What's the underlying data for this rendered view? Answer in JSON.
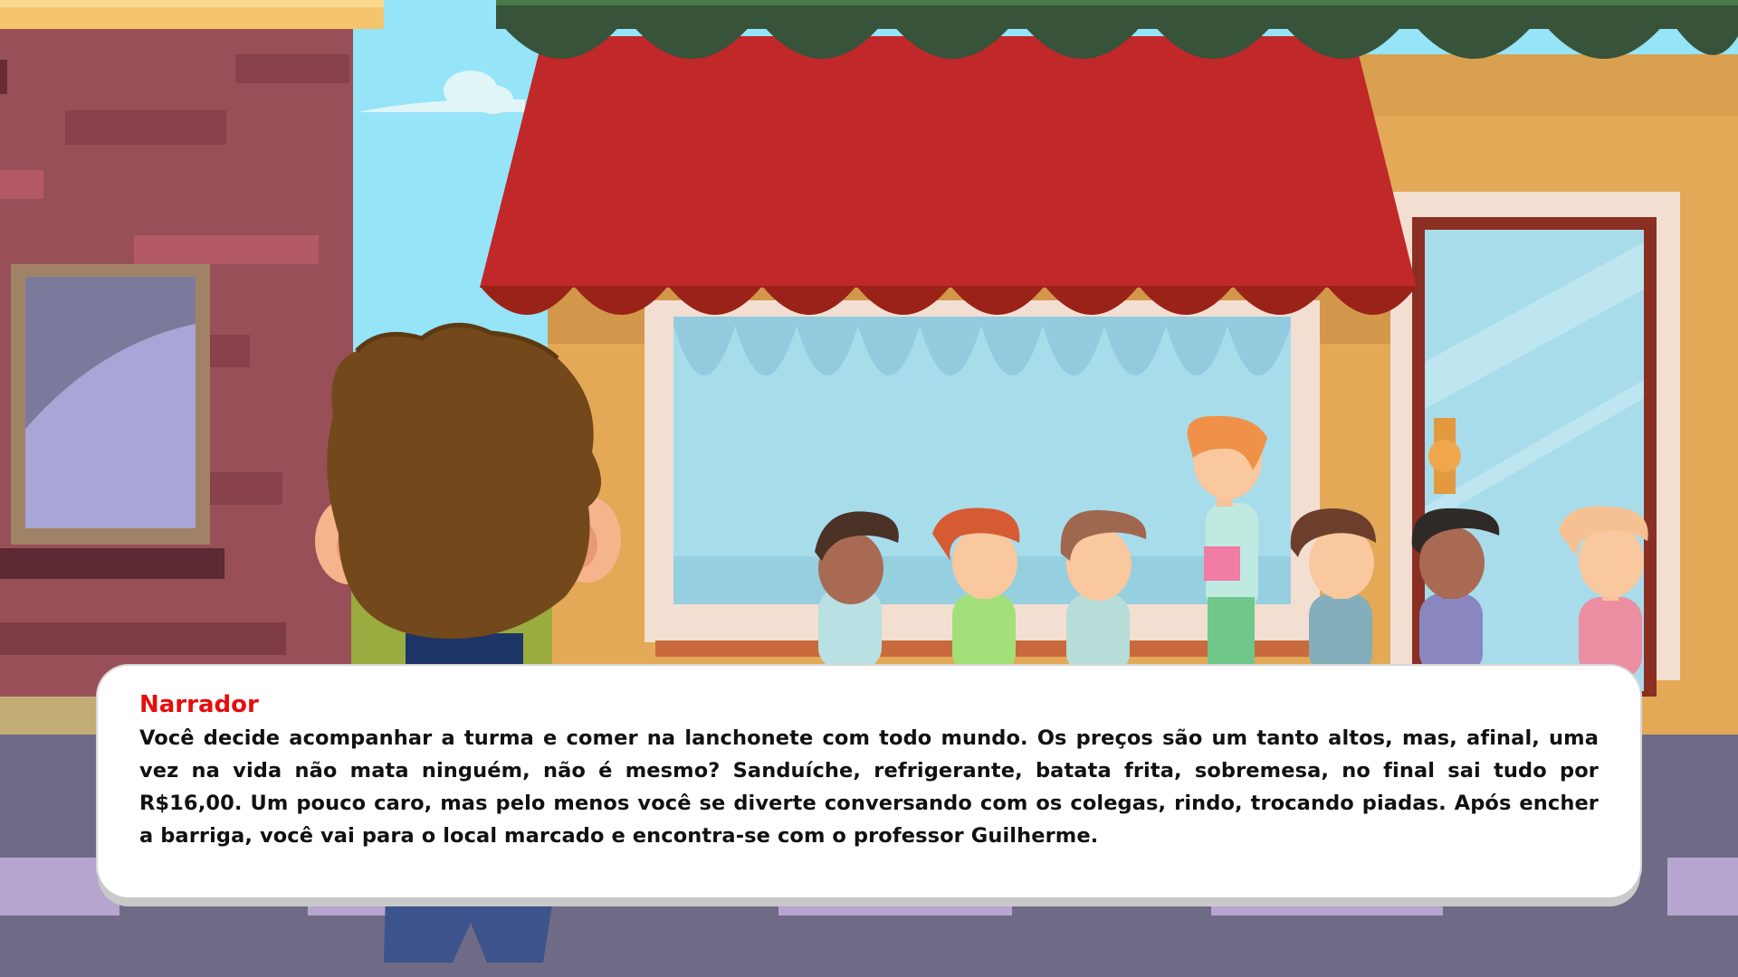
{
  "dialog": {
    "speaker": "Narrador",
    "text": "Você decide acompanhar a turma e comer na lanchonete com todo mundo. Os preços são um tanto altos, mas, afinal, uma vez na vida não mata ninguém, não é mesmo? Sanduíche, refrigerante, batata frita, sobremesa, no final sai tudo por R$16,00. Um pouco caro, mas pelo menos você se diverte conversando com os colegas, rindo, trocando piadas. Após encher a barriga, você vai para o local marcado e encontra-se com o professor Guilherme."
  },
  "colors": {
    "sky": "#96e4f8",
    "awning_red": "#c0282a",
    "awning_trim": "#37533a",
    "shop_wall": "#e3a957",
    "brick_wall": "#994f57",
    "street": "#6f6a86",
    "speaker_name": "#e60d0d"
  }
}
